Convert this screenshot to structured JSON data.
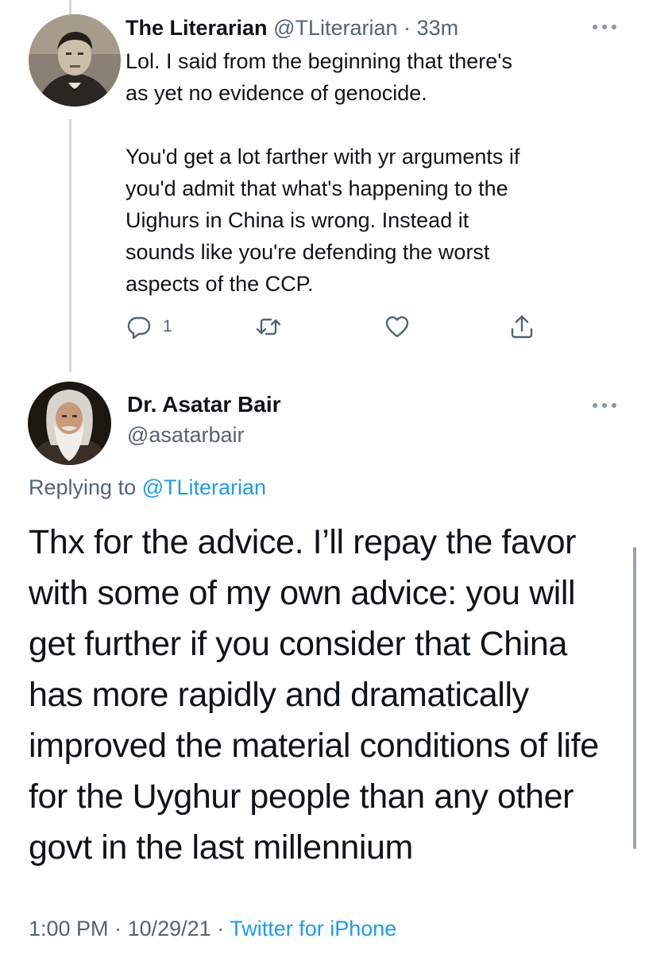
{
  "parent_tweet": {
    "display_name": "The Literarian",
    "handle": "@TLiterarian",
    "separator": "·",
    "time_ago": "33m",
    "text_paragraph_1": "Lol. I said from the beginning that there's\nas yet no evidence of genocide.",
    "text_paragraph_2": "You'd get a lot farther with yr arguments if\nyou'd admit that what's happening to the\nUighurs in China is wrong. Instead it\nsounds like you're defending the worst\naspects of the CCP.",
    "reply_count": "1",
    "actions": [
      "reply-icon",
      "retweet-icon",
      "like-icon",
      "share-icon"
    ]
  },
  "main_tweet": {
    "display_name": "Dr. Asatar Bair",
    "handle": "@asatarbair",
    "replying_to_prefix": "Replying to",
    "replying_to_handle": "@TLiterarian",
    "text": "Thx for the advice. I’ll repay the favor with some of my own advice: you will get further if you consider that China has more rapidly and dramatically improved the material conditions of life for the Uyghur people than any other govt in the last millennium",
    "time": "1:00 PM",
    "date": "10/29/21",
    "separator": "·",
    "source": "Twitter for iPhone"
  },
  "colors": {
    "link": "#1d9bf0",
    "secondary_text": "#536471",
    "primary_text": "#0f1419",
    "thread_line": "#cfd9de"
  }
}
